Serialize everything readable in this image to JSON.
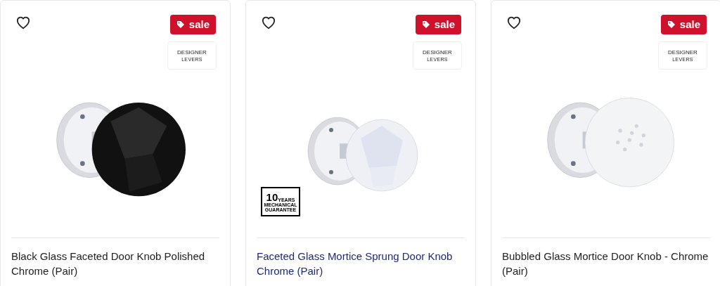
{
  "products": [
    {
      "kind": "faceted-black",
      "favorite": false,
      "sale": "sale",
      "brand": {
        "name": "DESIGNER",
        "sub": "LEVERS"
      },
      "title": "Black Glass Faceted Door Knob Polished Chrome (Pair)",
      "hovered": false
    },
    {
      "kind": "faceted-clear",
      "favorite": false,
      "sale": "sale",
      "brand": {
        "name": "DESIGNER",
        "sub": "LEVERS"
      },
      "guarantee": {
        "number": "10",
        "unit": "YEARS",
        "line1": "MECHANICAL",
        "line2": "GUARANTEE"
      },
      "title": "Faceted Glass Mortice Sprung Door Knob Chrome (Pair)",
      "hovered": true
    },
    {
      "kind": "bubbled",
      "favorite": false,
      "sale": "sale",
      "brand": {
        "name": "DESIGNER",
        "sub": "LEVERS"
      },
      "title": "Bubbled Glass Mortice Door Knob - Chrome (Pair)",
      "hovered": false
    }
  ]
}
